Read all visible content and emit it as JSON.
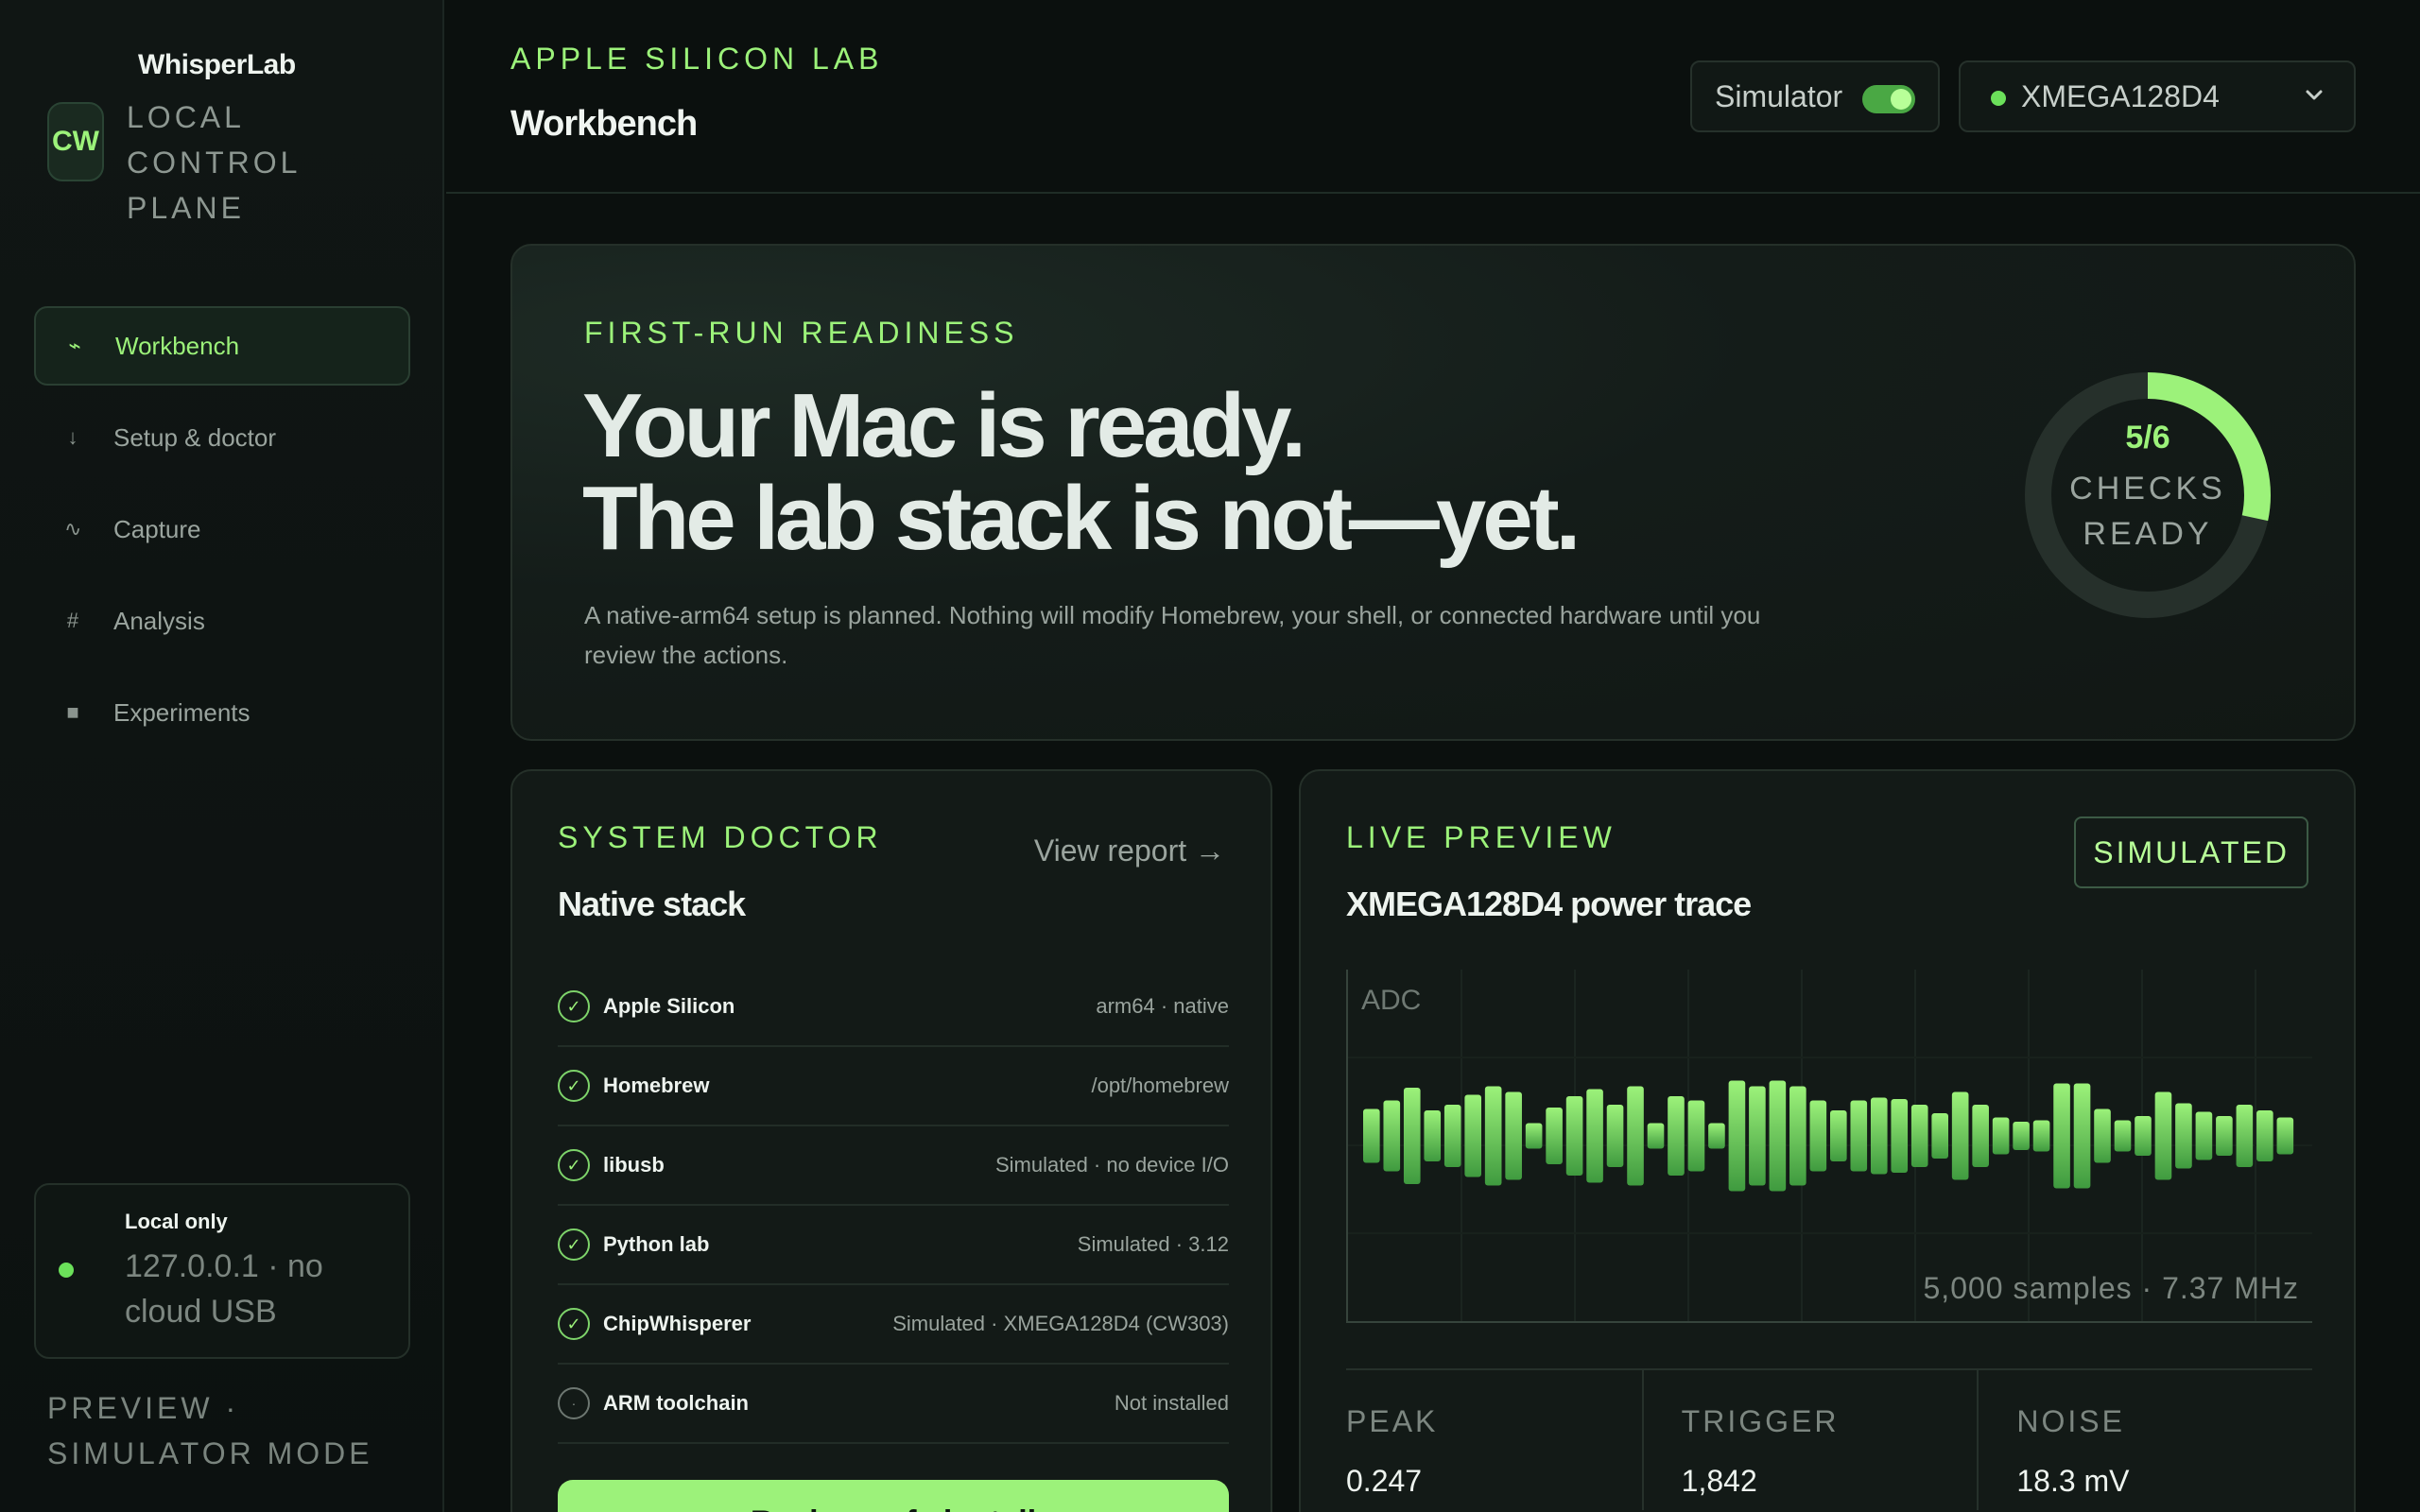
{
  "brand": {
    "logo": "CW",
    "name": "WhisperLab",
    "subtitle": "LOCAL CONTROL PLANE"
  },
  "nav": [
    {
      "label": "Workbench",
      "icon": "⌁",
      "active": true
    },
    {
      "label": "Setup & doctor",
      "icon": "↓",
      "active": false
    },
    {
      "label": "Capture",
      "icon": "∿",
      "active": false
    },
    {
      "label": "Analysis",
      "icon": "#",
      "active": false
    },
    {
      "label": "Experiments",
      "icon": "■",
      "active": false
    }
  ],
  "local": {
    "title": "Local only",
    "detail": "127.0.0.1 · no cloud USB"
  },
  "preview_mode": "PREVIEW · SIMULATOR MODE",
  "header": {
    "eyebrow": "APPLE SILICON LAB",
    "title": "Workbench",
    "simulator_label": "Simulator",
    "device": "XMEGA128D4"
  },
  "hero": {
    "eyebrow": "FIRST-RUN READINESS",
    "title_line1": "Your Mac is ready.",
    "title_line2": "The lab stack is not—yet.",
    "description": "A native-arm64 setup is planned. Nothing will modify Homebrew, your shell, or connected hardware until you review the actions.",
    "checks_ready": 5,
    "checks_total": 6,
    "ring_count": "5/6",
    "ring_label": "CHECKS READY"
  },
  "doctor": {
    "eyebrow": "SYSTEM DOCTOR",
    "title": "Native stack",
    "view_report": "View report →",
    "checks": [
      {
        "name": "Apple Silicon",
        "value": "arm64 · native",
        "ok": true
      },
      {
        "name": "Homebrew",
        "value": "/opt/homebrew",
        "ok": true
      },
      {
        "name": "libusb",
        "value": "Simulated · no device I/O",
        "ok": true
      },
      {
        "name": "Python lab",
        "value": "Simulated · 3.12",
        "ok": true
      },
      {
        "name": "ChipWhisperer",
        "value": "Simulated · XMEGA128D4 (CW303)",
        "ok": true
      },
      {
        "name": "ARM toolchain",
        "value": "Not installed",
        "ok": false
      }
    ],
    "cta_label": "Review safe install"
  },
  "live": {
    "eyebrow": "LIVE PREVIEW",
    "title": "XMEGA128D4 power trace",
    "badge": "SIMULATED",
    "axis_label": "ADC",
    "meta": "5,000 samples · 7.37 MHz",
    "bars": [
      0.38,
      0.5,
      0.68,
      0.36,
      0.44,
      0.58,
      0.7,
      0.62,
      0.18,
      0.4,
      0.56,
      0.66,
      0.44,
      0.7,
      0.18,
      0.56,
      0.5,
      0.18,
      0.78,
      0.7,
      0.78,
      0.7,
      0.5,
      0.36,
      0.5,
      0.54,
      0.52,
      0.44,
      0.32,
      0.62,
      0.44,
      0.26,
      0.2,
      0.22,
      0.74,
      0.74,
      0.38,
      0.22,
      0.28,
      0.62,
      0.46,
      0.34,
      0.28,
      0.44,
      0.36,
      0.26
    ],
    "stats": [
      {
        "label": "PEAK",
        "value": "0.247"
      },
      {
        "label": "TRIGGER",
        "value": "1,842"
      },
      {
        "label": "NOISE",
        "value": "18.3 mV"
      }
    ]
  }
}
